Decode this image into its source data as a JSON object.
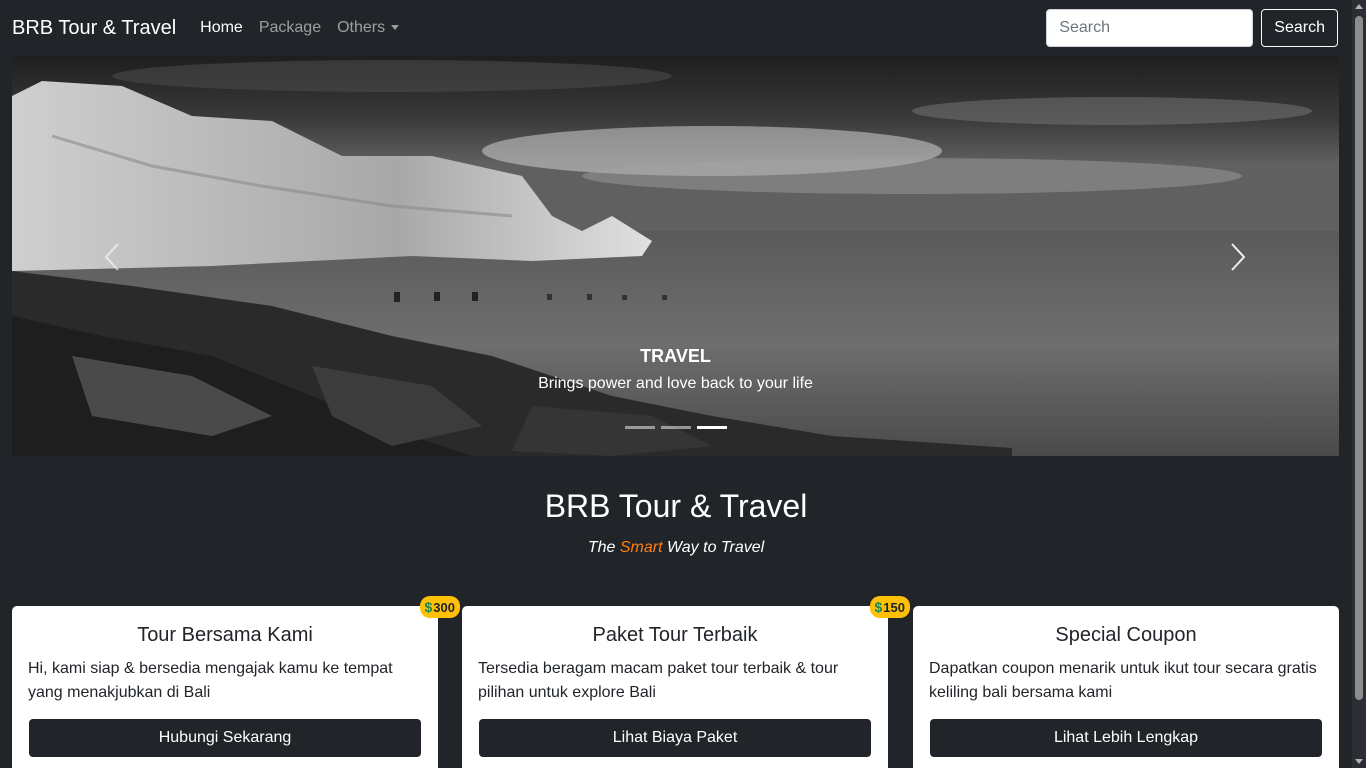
{
  "navbar": {
    "brand": "BRB Tour & Travel",
    "links": [
      {
        "label": "Home",
        "active": true
      },
      {
        "label": "Package",
        "active": false
      },
      {
        "label": "Others",
        "active": false
      }
    ],
    "search_placeholder": "Search",
    "search_button": "Search"
  },
  "carousel": {
    "caption_title": "TRAVEL",
    "caption_text": "Brings power and love back to your life",
    "slide_count": 3,
    "active_slide": 3
  },
  "hero": {
    "title": "BRB Tour & Travel",
    "tagline_before": "The ",
    "tagline_accent": "Smart",
    "tagline_after": " Way to Travel",
    "accent_color": "#fd7e14"
  },
  "cards": [
    {
      "title": "Tour Bersama Kami",
      "text": "Hi, kami siap & bersedia mengajak kamu ke tempat yang menakjubkan di Bali",
      "button": "Hubungi Sekarang",
      "badge": "300"
    },
    {
      "title": "Paket Tour Terbaik",
      "text": "Tersedia beragam macam paket tour terbaik & tour pilihan untuk explore Bali",
      "button": "Lihat Biaya Paket",
      "badge": "150"
    },
    {
      "title": "Special Coupon",
      "text": "Dapatkan coupon menarik untuk ikut tour secara gratis keliling bali bersama kami",
      "button": "Lihat Lebih Lengkap",
      "badge": ""
    }
  ]
}
